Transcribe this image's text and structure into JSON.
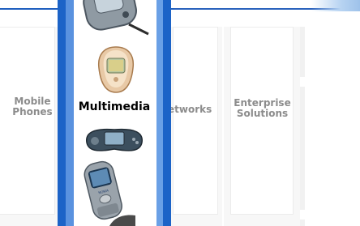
{
  "nav": {
    "mobile_phones": "Mobile\nPhones",
    "multimedia": "Multimedia",
    "networks": "etworks",
    "enterprise_solutions": "Enterprise\nSolutions"
  },
  "colors": {
    "selected_blue": "#1c63c7",
    "selected_light_blue": "#5a92df",
    "inactive_text": "#8c8c8c",
    "active_text": "#000000"
  },
  "icons": [
    "phone-top-icon",
    "phone-7600-icon",
    "phone-ngage-icon",
    "phone-6600-icon",
    "phone-partial-icon"
  ]
}
